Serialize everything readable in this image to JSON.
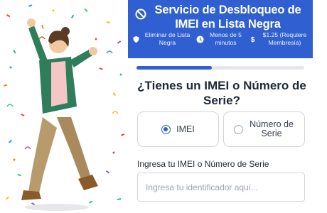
{
  "header": {
    "title": "Servicio de Desbloqueo de IMEI en Lista Negra",
    "features": [
      {
        "icon": "shield-icon",
        "label": "Eliminar de Lista Negra"
      },
      {
        "icon": "clock-icon",
        "label": "Menos de 5 minutos"
      },
      {
        "icon": "dollar-icon",
        "label": "$1.25 (Requiere Membresía)"
      }
    ]
  },
  "progress": {
    "value": 0.45
  },
  "form": {
    "question": "¿Tienes un IMEI o Número de Serie?",
    "options": [
      {
        "label": "IMEI",
        "selected": true
      },
      {
        "label": "Número de Serie",
        "selected": false
      }
    ],
    "field_label": "Ingresa tu IMEI o Número de Serie",
    "input_placeholder": "Ingresa tu identificador aquí...",
    "input_value": ""
  },
  "colors": {
    "accent": "#2f5fd0",
    "text": "#1f2937",
    "border": "#d1d5db"
  }
}
